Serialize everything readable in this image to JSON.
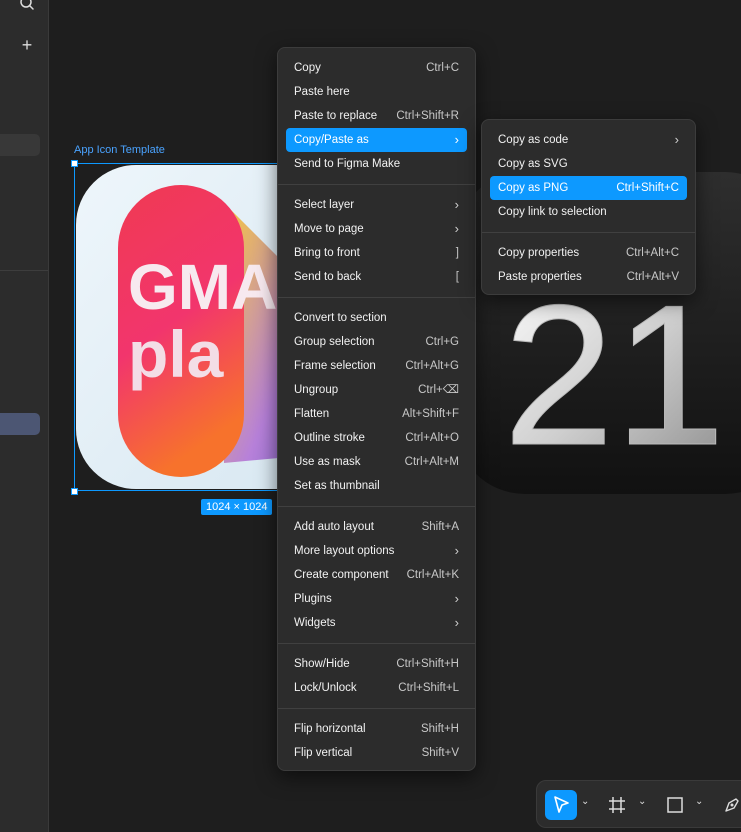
{
  "canvas": {
    "frame_label": "App Icon Template",
    "frame_size": "1024 × 1024",
    "icon_gm_line1": "GMA",
    "icon_gm_line2": "pla",
    "icon_number": "21"
  },
  "context_menu": {
    "items": [
      {
        "label": "Copy",
        "shortcut": "Ctrl+C"
      },
      {
        "label": "Paste here",
        "shortcut": ""
      },
      {
        "label": "Paste to replace",
        "shortcut": "Ctrl+Shift+R"
      },
      {
        "label": "Copy/Paste as",
        "shortcut": "›"
      },
      {
        "label": "Send to Figma Make",
        "shortcut": ""
      },
      {
        "label": "Select layer",
        "shortcut": "›"
      },
      {
        "label": "Move to page",
        "shortcut": "›"
      },
      {
        "label": "Bring to front",
        "shortcut": "]"
      },
      {
        "label": "Send to back",
        "shortcut": "["
      },
      {
        "label": "Convert to section",
        "shortcut": ""
      },
      {
        "label": "Group selection",
        "shortcut": "Ctrl+G"
      },
      {
        "label": "Frame selection",
        "shortcut": "Ctrl+Alt+G"
      },
      {
        "label": "Ungroup",
        "shortcut": "Ctrl+⌫"
      },
      {
        "label": "Flatten",
        "shortcut": "Alt+Shift+F"
      },
      {
        "label": "Outline stroke",
        "shortcut": "Ctrl+Alt+O"
      },
      {
        "label": "Use as mask",
        "shortcut": "Ctrl+Alt+M"
      },
      {
        "label": "Set as thumbnail",
        "shortcut": ""
      },
      {
        "label": "Add auto layout",
        "shortcut": "Shift+A"
      },
      {
        "label": "More layout options",
        "shortcut": "›"
      },
      {
        "label": "Create component",
        "shortcut": "Ctrl+Alt+K"
      },
      {
        "label": "Plugins",
        "shortcut": "›"
      },
      {
        "label": "Widgets",
        "shortcut": "›"
      },
      {
        "label": "Show/Hide",
        "shortcut": "Ctrl+Shift+H"
      },
      {
        "label": "Lock/Unlock",
        "shortcut": "Ctrl+Shift+L"
      },
      {
        "label": "Flip horizontal",
        "shortcut": "Shift+H"
      },
      {
        "label": "Flip vertical",
        "shortcut": "Shift+V"
      }
    ]
  },
  "submenu": {
    "items": [
      {
        "label": "Copy as code",
        "shortcut": "›"
      },
      {
        "label": "Copy as SVG",
        "shortcut": ""
      },
      {
        "label": "Copy as PNG",
        "shortcut": "Ctrl+Shift+C"
      },
      {
        "label": "Copy link to selection",
        "shortcut": ""
      },
      {
        "label": "Copy properties",
        "shortcut": "Ctrl+Alt+C"
      },
      {
        "label": "Paste properties",
        "shortcut": "Ctrl+Alt+V"
      }
    ]
  },
  "sidebar": {
    "plus_symbol": "+"
  },
  "toolbar": {
    "tools": [
      {
        "name": "move-tool",
        "active": true
      },
      {
        "name": "frame-tool",
        "active": false
      },
      {
        "name": "rectangle-tool",
        "active": false
      },
      {
        "name": "pen-tool",
        "active": false
      }
    ]
  },
  "colors": {
    "accent": "#0d99ff",
    "menu_bg": "#2c2c2c",
    "canvas_bg": "#1e1e1e"
  }
}
